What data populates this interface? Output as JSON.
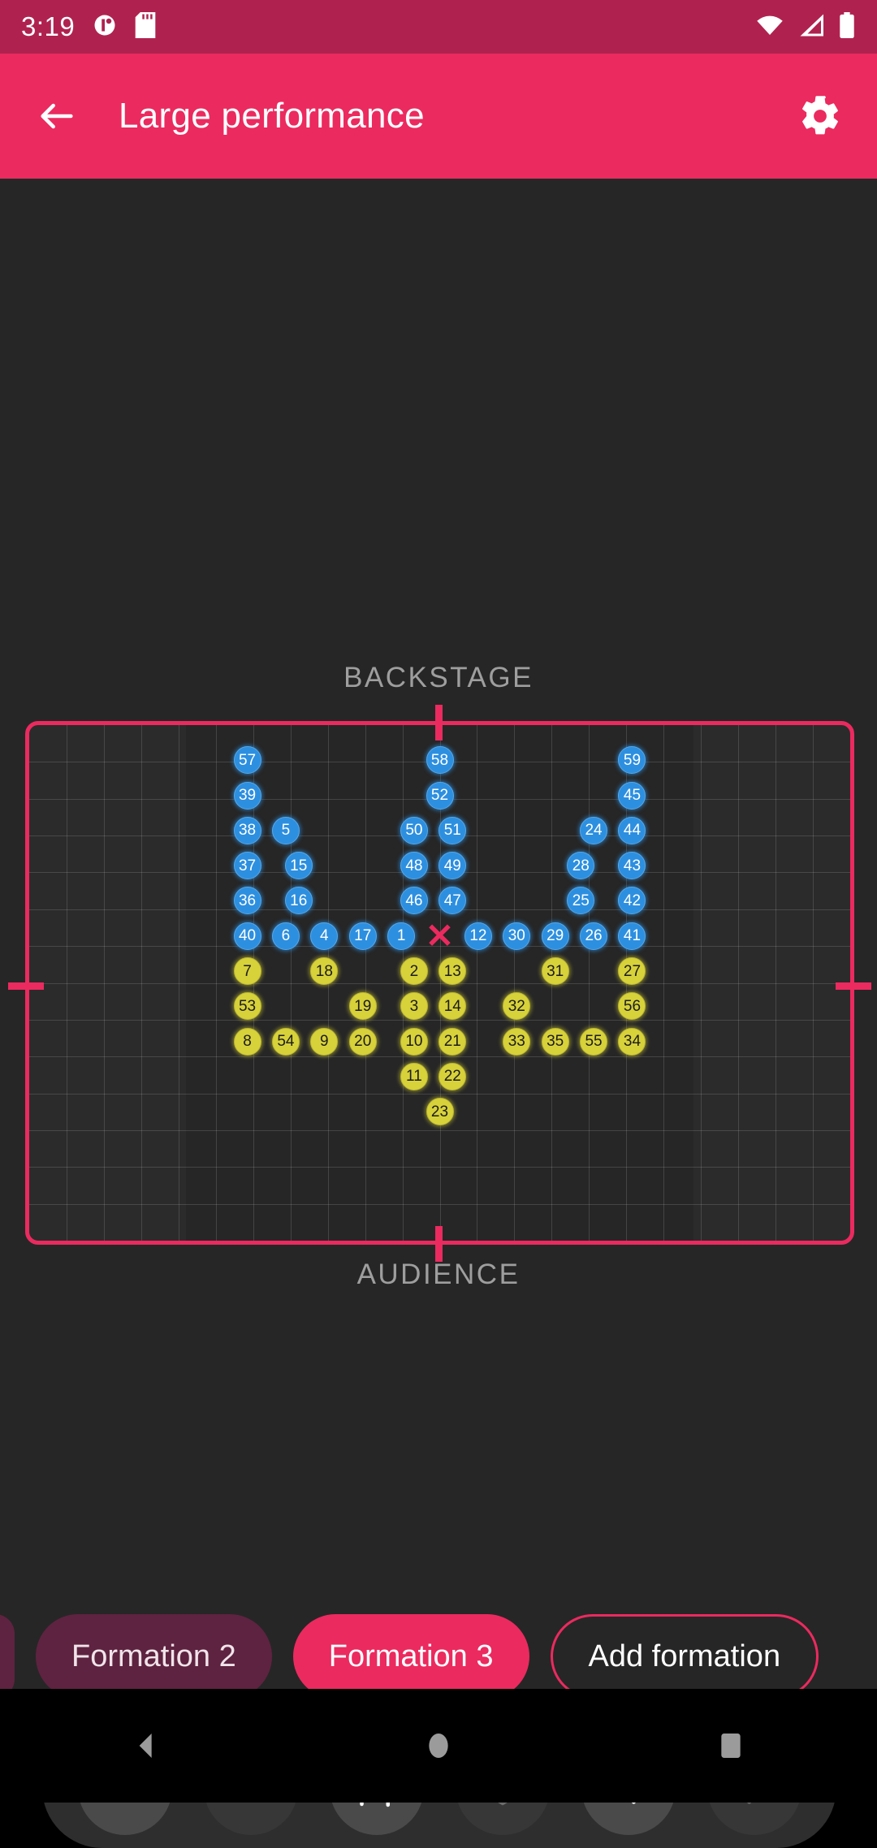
{
  "status_bar": {
    "time": "3:19",
    "icons_left": [
      "app-notification-icon",
      "sd-card-icon"
    ],
    "icons_right": [
      "wifi-icon",
      "cellular-signal-icon",
      "battery-icon"
    ],
    "background_color": "#AF2250"
  },
  "app_bar": {
    "back_icon": "back-arrow-icon",
    "title": "Large performance",
    "settings_icon": "gear-icon",
    "background_color": "#EB2A5F"
  },
  "stage": {
    "backstage_label": "BACKSTAGE",
    "audience_label": "AUDIENCE",
    "border_color": "#EB2A5F",
    "center_marker": "✕",
    "grid_columns": 22,
    "grid_rows": 14,
    "markers": [
      {
        "id": "57",
        "color": "blue",
        "col": 8.5,
        "row": 1.5
      },
      {
        "id": "58",
        "color": "blue",
        "col": 16.0,
        "row": 1.5
      },
      {
        "id": "59",
        "color": "blue",
        "col": 23.5,
        "row": 1.5
      },
      {
        "id": "39",
        "color": "blue",
        "col": 8.5,
        "row": 3.0
      },
      {
        "id": "52",
        "color": "blue",
        "col": 16.0,
        "row": 3.0
      },
      {
        "id": "45",
        "color": "blue",
        "col": 23.5,
        "row": 3.0
      },
      {
        "id": "38",
        "color": "blue",
        "col": 8.5,
        "row": 4.5
      },
      {
        "id": "5",
        "color": "blue",
        "col": 10.0,
        "row": 4.5
      },
      {
        "id": "50",
        "color": "blue",
        "col": 15.0,
        "row": 4.5
      },
      {
        "id": "51",
        "color": "blue",
        "col": 16.5,
        "row": 4.5
      },
      {
        "id": "24",
        "color": "blue",
        "col": 22.0,
        "row": 4.5
      },
      {
        "id": "44",
        "color": "blue",
        "col": 23.5,
        "row": 4.5
      },
      {
        "id": "37",
        "color": "blue",
        "col": 8.5,
        "row": 6.0
      },
      {
        "id": "15",
        "color": "blue",
        "col": 10.5,
        "row": 6.0
      },
      {
        "id": "48",
        "color": "blue",
        "col": 15.0,
        "row": 6.0
      },
      {
        "id": "49",
        "color": "blue",
        "col": 16.5,
        "row": 6.0
      },
      {
        "id": "28",
        "color": "blue",
        "col": 21.5,
        "row": 6.0
      },
      {
        "id": "43",
        "color": "blue",
        "col": 23.5,
        "row": 6.0
      },
      {
        "id": "36",
        "color": "blue",
        "col": 8.5,
        "row": 7.5
      },
      {
        "id": "16",
        "color": "blue",
        "col": 10.5,
        "row": 7.5
      },
      {
        "id": "46",
        "color": "blue",
        "col": 15.0,
        "row": 7.5
      },
      {
        "id": "47",
        "color": "blue",
        "col": 16.5,
        "row": 7.5
      },
      {
        "id": "25",
        "color": "blue",
        "col": 21.5,
        "row": 7.5
      },
      {
        "id": "42",
        "color": "blue",
        "col": 23.5,
        "row": 7.5
      },
      {
        "id": "40",
        "color": "blue",
        "col": 8.5,
        "row": 9.0
      },
      {
        "id": "6",
        "color": "blue",
        "col": 10.0,
        "row": 9.0
      },
      {
        "id": "4",
        "color": "blue",
        "col": 11.5,
        "row": 9.0
      },
      {
        "id": "17",
        "color": "blue",
        "col": 13.0,
        "row": 9.0
      },
      {
        "id": "1",
        "color": "blue",
        "col": 14.5,
        "row": 9.0
      },
      {
        "id": "12",
        "color": "blue",
        "col": 17.5,
        "row": 9.0
      },
      {
        "id": "30",
        "color": "blue",
        "col": 19.0,
        "row": 9.0
      },
      {
        "id": "29",
        "color": "blue",
        "col": 20.5,
        "row": 9.0
      },
      {
        "id": "26",
        "color": "blue",
        "col": 22.0,
        "row": 9.0
      },
      {
        "id": "41",
        "color": "blue",
        "col": 23.5,
        "row": 9.0
      },
      {
        "id": "7",
        "color": "yellow",
        "col": 8.5,
        "row": 10.5
      },
      {
        "id": "18",
        "color": "yellow",
        "col": 11.5,
        "row": 10.5
      },
      {
        "id": "2",
        "color": "yellow",
        "col": 15.0,
        "row": 10.5
      },
      {
        "id": "13",
        "color": "yellow",
        "col": 16.5,
        "row": 10.5
      },
      {
        "id": "31",
        "color": "yellow",
        "col": 20.5,
        "row": 10.5
      },
      {
        "id": "27",
        "color": "yellow",
        "col": 23.5,
        "row": 10.5
      },
      {
        "id": "53",
        "color": "yellow",
        "col": 8.5,
        "row": 12.0
      },
      {
        "id": "19",
        "color": "yellow",
        "col": 13.0,
        "row": 12.0
      },
      {
        "id": "3",
        "color": "yellow",
        "col": 15.0,
        "row": 12.0
      },
      {
        "id": "14",
        "color": "yellow",
        "col": 16.5,
        "row": 12.0
      },
      {
        "id": "32",
        "color": "yellow",
        "col": 19.0,
        "row": 12.0
      },
      {
        "id": "56",
        "color": "yellow",
        "col": 23.5,
        "row": 12.0
      },
      {
        "id": "8",
        "color": "yellow",
        "col": 8.5,
        "row": 13.5
      },
      {
        "id": "54",
        "color": "yellow",
        "col": 10.0,
        "row": 13.5
      },
      {
        "id": "9",
        "color": "yellow",
        "col": 11.5,
        "row": 13.5
      },
      {
        "id": "20",
        "color": "yellow",
        "col": 13.0,
        "row": 13.5
      },
      {
        "id": "10",
        "color": "yellow",
        "col": 15.0,
        "row": 13.5
      },
      {
        "id": "21",
        "color": "yellow",
        "col": 16.5,
        "row": 13.5
      },
      {
        "id": "33",
        "color": "yellow",
        "col": 19.0,
        "row": 13.5
      },
      {
        "id": "35",
        "color": "yellow",
        "col": 20.5,
        "row": 13.5
      },
      {
        "id": "55",
        "color": "yellow",
        "col": 22.0,
        "row": 13.5
      },
      {
        "id": "34",
        "color": "yellow",
        "col": 23.5,
        "row": 13.5
      },
      {
        "id": "11",
        "color": "yellow",
        "col": 15.0,
        "row": 15.0
      },
      {
        "id": "22",
        "color": "yellow",
        "col": 16.5,
        "row": 15.0
      },
      {
        "id": "23",
        "color": "yellow",
        "col": 16.0,
        "row": 16.5
      }
    ]
  },
  "formations": {
    "items": [
      {
        "label": "Formation 2",
        "state": "past"
      },
      {
        "label": "Formation 3",
        "state": "active"
      },
      {
        "label": "Add formation",
        "state": "outline"
      }
    ]
  },
  "toolbar": {
    "buttons": [
      {
        "icon": "undo-icon",
        "enabled": true
      },
      {
        "icon": "redo-icon",
        "enabled": false
      },
      {
        "icon": "add-person-icon",
        "enabled": true
      },
      {
        "icon": "layers-icon",
        "enabled": false
      },
      {
        "icon": "previous-icon",
        "enabled": true
      },
      {
        "icon": "next-icon",
        "enabled": false
      }
    ]
  },
  "nav_bar": {
    "buttons": [
      "back-nav-icon",
      "home-nav-icon",
      "recents-nav-icon"
    ]
  }
}
